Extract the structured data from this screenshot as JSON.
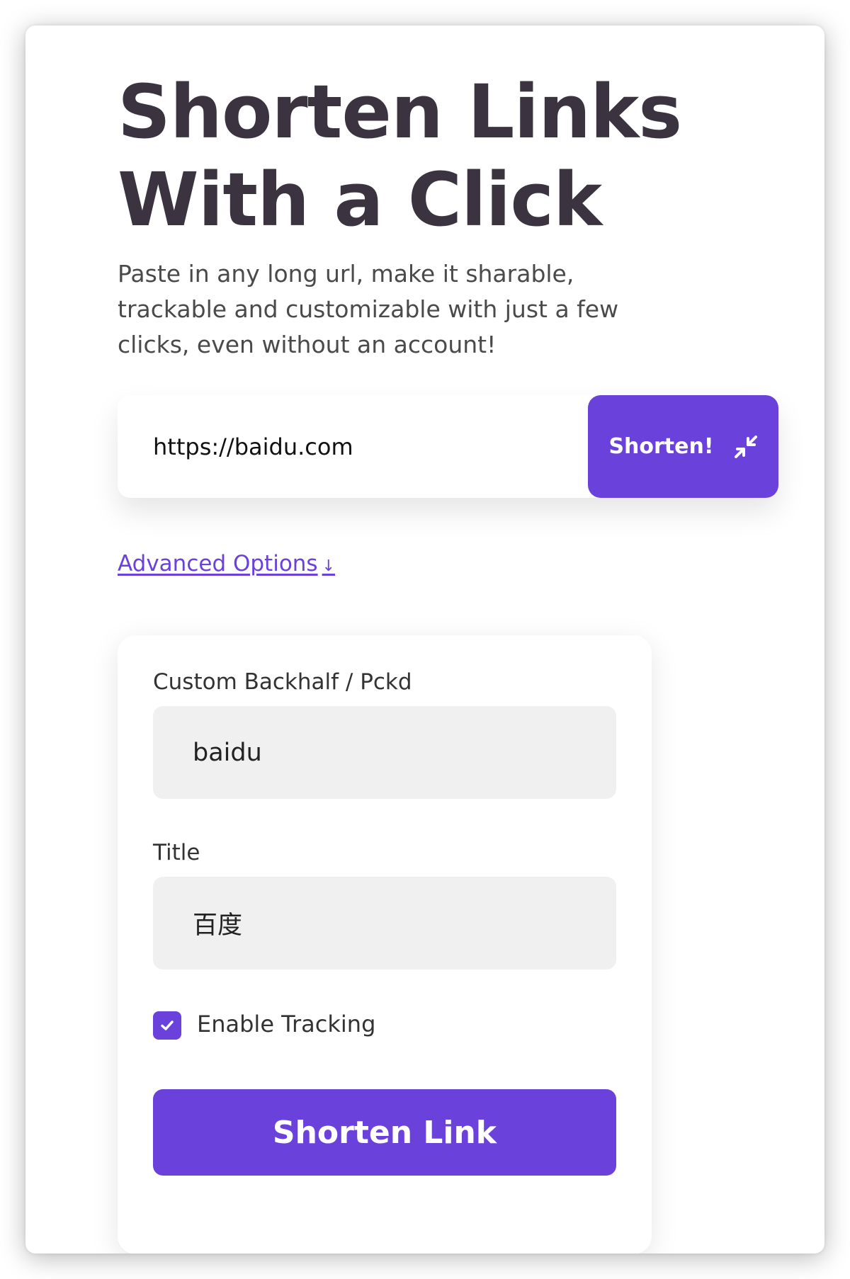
{
  "hero": {
    "title_line1": "Shorten Links",
    "title_line2": "With a Click",
    "subtitle": "Paste in any long url, make it sharable, trackable and customizable with just a few clicks, even without an account!"
  },
  "url_form": {
    "url_value": "https://baidu.com",
    "shorten_label": "Shorten!",
    "shorten_icon": "compress-arrows-icon"
  },
  "advanced_options": {
    "link_label": "Advanced Options",
    "arrow": "↓"
  },
  "options": {
    "backhalf_label": "Custom Backhalf / Pckd",
    "backhalf_value": "baidu",
    "title_label": "Title",
    "title_value": "百度",
    "tracking_label": "Enable Tracking",
    "tracking_checked": true,
    "submit_label": "Shorten Link"
  },
  "colors": {
    "accent": "#6b41dc",
    "heading": "#3b3440",
    "input_bg": "#f0f0f0"
  }
}
